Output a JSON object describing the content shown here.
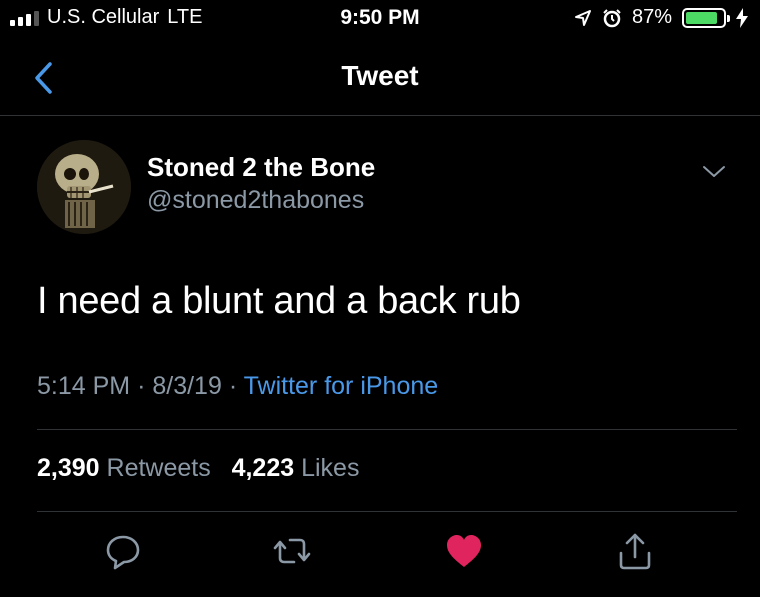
{
  "status_bar": {
    "carrier": "U.S. Cellular",
    "network": "LTE",
    "time": "9:50 PM",
    "battery": "87%",
    "battery_level": 0.87
  },
  "nav": {
    "title": "Tweet"
  },
  "tweet": {
    "display_name": "Stoned 2 the Bone",
    "handle": "@stoned2thabones",
    "text": "I need a blunt and a back rub",
    "time": "5:14 PM",
    "date": "8/3/19",
    "separator": "·",
    "source": "Twitter for iPhone",
    "retweets_count": "2,390",
    "retweets_label": "Retweets",
    "likes_count": "4,223",
    "likes_label": "Likes"
  },
  "icons": {
    "back": "chevron-left-icon",
    "menu": "chevron-down-icon",
    "reply": "reply-icon",
    "retweet": "retweet-icon",
    "like": "heart-icon",
    "share": "share-icon"
  },
  "colors": {
    "accent": "#4a99e9",
    "like": "#e0245e",
    "muted": "#8b98a5",
    "battery": "#4cd964"
  }
}
